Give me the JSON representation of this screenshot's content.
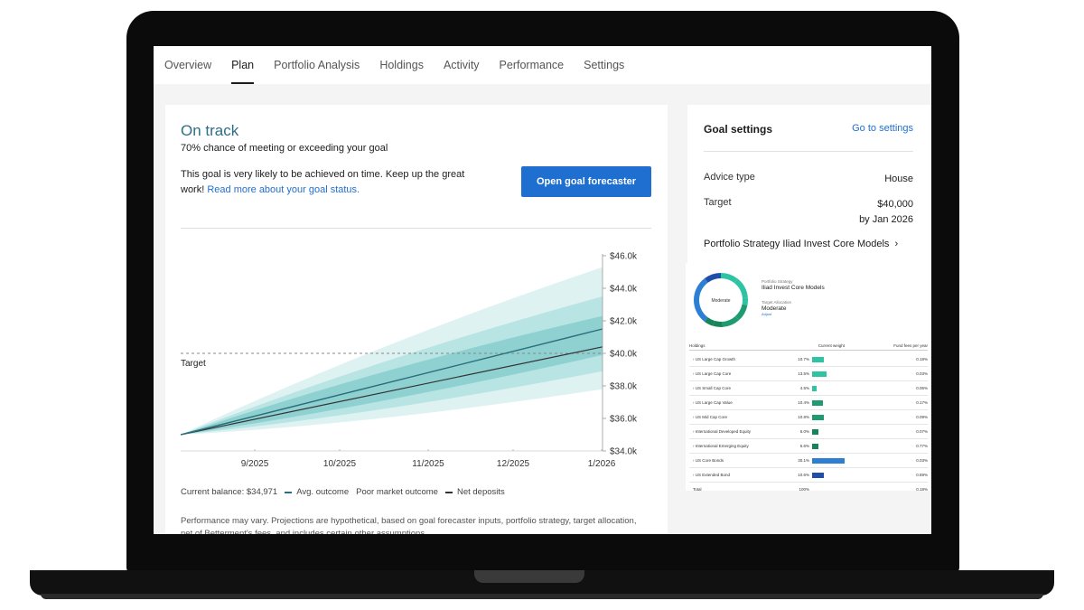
{
  "nav": {
    "tabs": [
      "Overview",
      "Plan",
      "Portfolio Analysis",
      "Holdings",
      "Activity",
      "Performance",
      "Settings"
    ],
    "active": "Plan"
  },
  "status": {
    "title": "On track",
    "subtitle": "70% chance of meeting or exceeding your goal",
    "desc": "This goal is very likely to be achieved on time. Keep up the great work!",
    "link": "Read more about your goal status.",
    "button": "Open goal forecaster"
  },
  "chart_data": {
    "type": "area",
    "x": [
      "9/2025",
      "10/2025",
      "11/2025",
      "12/2025",
      "1/2026"
    ],
    "y_ticks": [
      "$46.0k",
      "$44.0k",
      "$42.0k",
      "$40.0k",
      "$38.0k",
      "$36.0k",
      "$34.0k"
    ],
    "ylim": [
      34000,
      46000
    ],
    "target": 40000,
    "target_label": "Target",
    "start_value": 35000,
    "series": [
      {
        "name": "Avg. outcome",
        "end_value": 41500
      },
      {
        "name": "Net deposits",
        "end_value": 40400
      }
    ],
    "bands": [
      {
        "low_end": 37800,
        "high_end": 45300
      },
      {
        "low_end": 38900,
        "high_end": 43500
      },
      {
        "low_end": 39900,
        "high_end": 42300
      }
    ],
    "colors": {
      "outer": "#dff2f2",
      "mid": "#b8e4e4",
      "inner": "#8fd1d1",
      "avg": "#2a6e7c",
      "deposits": "#333333",
      "target_line": "#888888"
    }
  },
  "legend": {
    "balance": "Current balance: $34,971",
    "avg": "Avg. outcome",
    "poor": "Poor market outcome",
    "deposits": "Net deposits"
  },
  "disclaimer": "Performance may vary. Projections are hypothetical, based on goal forecaster inputs, portfolio strategy, target allocation, net of Betterment's fees, and includes certain other assumptions.",
  "goal_settings": {
    "title": "Goal settings",
    "link": "Go to settings",
    "advice_label": "Advice type",
    "advice_value": "House",
    "target_label": "Target",
    "target_value": "$40,000",
    "target_date": "by Jan 2026",
    "strategy_link": "Portfolio Strategy Iliad Invest Core Models"
  },
  "allocation": {
    "donut_label": "Moderate",
    "strategy_label": "Portfolio Strategy",
    "strategy_value": "Iliad Invest Core Models",
    "target_label": "Target Allocation",
    "target_value": "Moderate",
    "adjust": "Adjust",
    "headers": {
      "name": "Holdings",
      "weight": "Current weight",
      "fee": "Fund fees per year"
    },
    "rows": [
      {
        "name": "US Large Cap Growth",
        "weight": "10.7%",
        "pct": 10.7,
        "fee": "0.18%",
        "color": "#2ec4a3"
      },
      {
        "name": "US Large Cap Core",
        "weight": "13.5%",
        "pct": 13.5,
        "fee": "0.03%",
        "color": "#2ec4a3"
      },
      {
        "name": "US Small Cap Core",
        "weight": "4.5%",
        "pct": 4.5,
        "fee": "0.06%",
        "color": "#2ec4a3"
      },
      {
        "name": "US Large Cap Value",
        "weight": "10.4%",
        "pct": 10.4,
        "fee": "0.17%",
        "color": "#1f9b72"
      },
      {
        "name": "US Mid Cap Core",
        "weight": "10.8%",
        "pct": 10.8,
        "fee": "0.09%",
        "color": "#1f9b72"
      },
      {
        "name": "International Developed Equity",
        "weight": "6.0%",
        "pct": 6.0,
        "fee": "0.07%",
        "color": "#17855a"
      },
      {
        "name": "International Emerging Equity",
        "weight": "5.6%",
        "pct": 5.6,
        "fee": "0.77%",
        "color": "#17855a"
      },
      {
        "name": "US Core Bonds",
        "weight": "30.1%",
        "pct": 30.1,
        "fee": "0.03%",
        "color": "#2d7fd3"
      },
      {
        "name": "US Extended Bond",
        "weight": "10.6%",
        "pct": 10.6,
        "fee": "0.89%",
        "color": "#1f4fa8"
      }
    ],
    "total_label": "Total",
    "total_weight": "100%",
    "total_fee": "0.18%"
  }
}
